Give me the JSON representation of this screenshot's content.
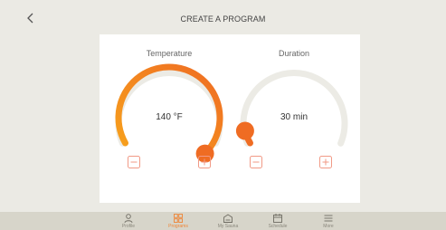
{
  "header": {
    "title": "CREATE A PROGRAM",
    "back_icon": "chevron-left-icon"
  },
  "temperature": {
    "label": "Temperature",
    "value": "140 °F",
    "level": 0.85,
    "decrease_icon": "minus-icon",
    "increase_icon": "plus-icon"
  },
  "duration": {
    "label": "Duration",
    "value": "30 min",
    "level": 0.05,
    "decrease_icon": "minus-icon",
    "increase_icon": "plus-icon"
  },
  "nav": {
    "items": [
      {
        "label": "Profile",
        "icon": "user-icon",
        "active": false
      },
      {
        "label": "Programs",
        "icon": "grid-icon",
        "active": true
      },
      {
        "label": "My Sauna",
        "icon": "sauna-icon",
        "active": false
      },
      {
        "label": "Schedule",
        "icon": "calendar-icon",
        "active": false
      },
      {
        "label": "More",
        "icon": "menu-icon",
        "active": false
      }
    ]
  },
  "colors": {
    "accent": "#ef6c23",
    "gradient_start": "#f7a21c",
    "track": "#ecebe5",
    "control": "#f19a86",
    "background": "#ebeae4",
    "nav_bar": "#d7d5ca"
  }
}
